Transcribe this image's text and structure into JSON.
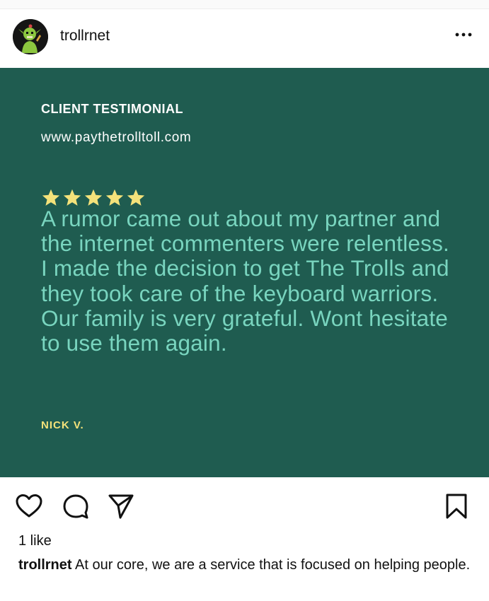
{
  "header": {
    "username": "trollrnet",
    "avatar_icon": "troll-avatar-icon",
    "more_icon": "more-options-icon"
  },
  "post": {
    "background_color": "#1f5c50",
    "label": "CLIENT TESTIMONIAL",
    "url": "www.paythetrolltoll.com",
    "rating": 5,
    "star_color": "#f4e27a",
    "quote_color": "#79d5bf",
    "quote": "A rumor came out about my partner and the internet commenters were relentless. I made the decision to get The Trolls and they took care of the keyboard warriors. Our family is very grateful. Wont hesitate to use them again.",
    "author": "NICK V."
  },
  "actions": {
    "like_icon": "heart-icon",
    "comment_icon": "comment-icon",
    "share_icon": "send-icon",
    "save_icon": "bookmark-icon"
  },
  "likes": "1 like",
  "caption": {
    "username": "trollrnet",
    "text": "At our core, we are a service that is focused on helping people."
  }
}
